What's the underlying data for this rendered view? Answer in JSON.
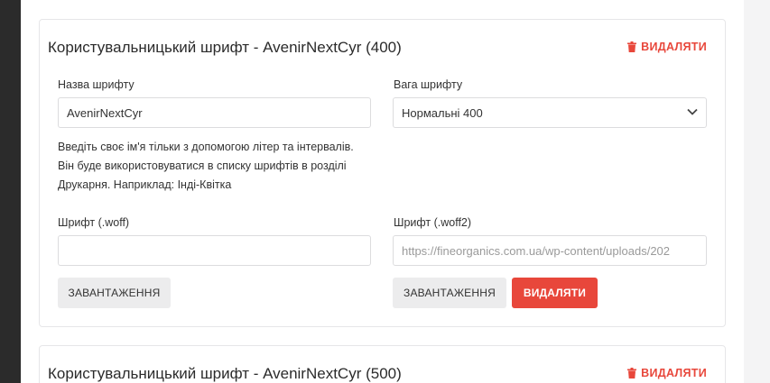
{
  "cards": [
    {
      "title": "Користувальницький шрифт - AvenirNextCyr (400)",
      "delete_label": "ВИДАЛЯТИ",
      "font_name_label": "Назва шрифту",
      "font_name_value": "AvenirNextCyr",
      "font_weight_label": "Вага шрифту",
      "font_weight_value": "Нормальні 400",
      "help_lines": [
        "Введіть своє ім'я тільки з допомогою літер та інтервалів.",
        "Він буде використовуватися в списку шрифтів в розділі",
        "Друкарня. Наприклад: Інді-Квітка"
      ],
      "woff_label": "Шрифт (.woff)",
      "woff_value": "",
      "woff2_label": "Шрифт (.woff2)",
      "woff2_value": "https://fineorganics.com.ua/wp-content/uploads/202",
      "upload_label": "ЗАВАНТАЖЕННЯ",
      "upload2_label": "ЗАВАНТАЖЕННЯ",
      "remove_label": "ВИДАЛЯТИ"
    },
    {
      "title": "Користувальницький шрифт - AvenirNextCyr (500)",
      "delete_label": "ВИДАЛЯТИ"
    }
  ],
  "colors": {
    "danger": "#e8473b",
    "sidebar": "#2b2b2b"
  }
}
